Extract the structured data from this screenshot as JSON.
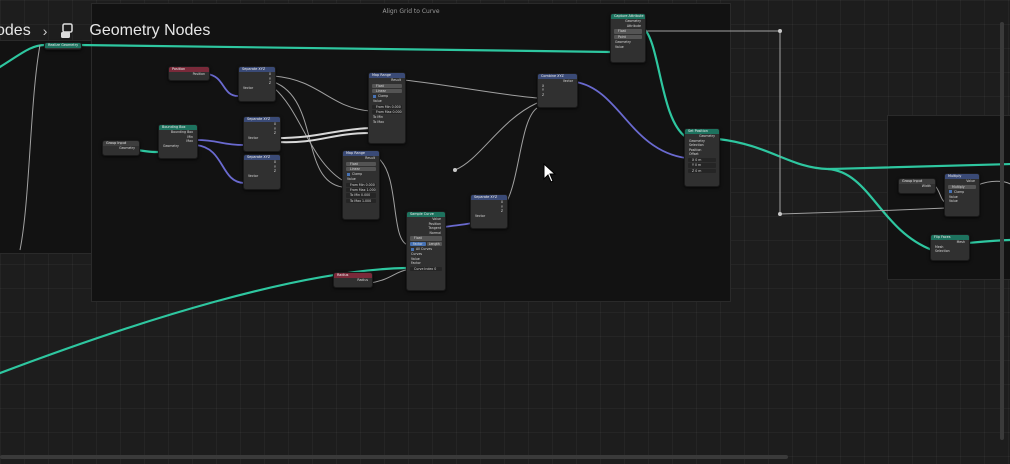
{
  "editor": {
    "title": "Geometry Nodes",
    "breadcrumb_prev": "odes"
  },
  "frames": {
    "align": "Align Grid to Curve"
  },
  "colors": {
    "geometry_socket": "#2ec7a0",
    "vector_socket": "#6363c7",
    "float_socket": "#a1a1a1",
    "field_header": "#3a4a76",
    "geometry_header": "#1d725e",
    "input_header": "#7a2a3a"
  },
  "nodes": {
    "realize": {
      "title": "Realize Geometry"
    },
    "position1": {
      "title": "Position",
      "out": "Position"
    },
    "sep1": {
      "title": "Separate XYZ",
      "x": "X",
      "y": "Y",
      "z": "Z",
      "vec": "Vector"
    },
    "bbox": {
      "title": "Bounding Box",
      "out_bbox": "Bounding Box",
      "min": "Min",
      "max": "Max",
      "geo": "Geometry"
    },
    "group_in1": {
      "title": "Group Input",
      "geo": "Geometry"
    },
    "sep2": {
      "title": "Separate XYZ",
      "x": "X",
      "y": "Y",
      "z": "Z",
      "vec": "Vector"
    },
    "sep3": {
      "title": "Separate XYZ",
      "x": "X",
      "y": "Y",
      "z": "Z",
      "vec": "Vector"
    },
    "map1": {
      "title": "Map Range",
      "result": "Result",
      "dtype": "Float",
      "interp": "Linear",
      "clamp": "Clamp",
      "value": "Value",
      "from_min": "From Min",
      "from_max": "From Max",
      "to_min": "To Min",
      "to_max": "To Max",
      "from_min_v": "0.000",
      "from_max_v": "0.000"
    },
    "map2": {
      "title": "Map Range",
      "result": "Result",
      "dtype": "Float",
      "interp": "Linear",
      "clamp": "Clamp",
      "value": "Value",
      "from_min": "From Min",
      "from_max": "From Max",
      "to_min": "To Min",
      "to_max": "To Max",
      "from_min_v": "0.000",
      "from_max_v": "1.000",
      "to_min_v": "0.000",
      "to_max_v": "1.000"
    },
    "combine": {
      "title": "Combine XYZ",
      "vector": "Vector",
      "x": "X",
      "y": "Y",
      "z": "Z"
    },
    "sample": {
      "title": "Sample Curve",
      "value": "Value",
      "position": "Position",
      "tangent": "Tangent",
      "normal": "Normal",
      "dtype": "Float",
      "mode_a": "Factor",
      "mode_b": "Length",
      "all_curves": "All Curves",
      "curves": "Curves",
      "value_in": "Value",
      "factor": "Factor",
      "curve_index": "Curve Index",
      "curve_index_v": "0"
    },
    "sep4": {
      "title": "Separate XYZ",
      "x": "X",
      "y": "Y",
      "z": "Z",
      "vec": "Vector"
    },
    "radius": {
      "title": "Radius",
      "out": "Radius"
    },
    "capture": {
      "title": "Capture Attribute",
      "geo": "Geometry",
      "attr": "Attribute",
      "dtype": "Float",
      "domain": "Point",
      "geo_in": "Geometry",
      "value": "Value"
    },
    "setpos": {
      "title": "Set Position",
      "geo_out": "Geometry",
      "geo": "Geometry",
      "sel": "Selection",
      "pos": "Position",
      "offset": "Offset",
      "ox": "X",
      "oy": "Y",
      "oz": "Z",
      "ov": "0 m"
    },
    "group_in2": {
      "title": "Group Input",
      "out": "Width"
    },
    "multiply": {
      "title": "Multiply",
      "value": "Value",
      "op": "Multiply",
      "clamp": "Clamp",
      "v1": "Value",
      "v2": "Value"
    },
    "flip": {
      "title": "Flip Faces",
      "mesh_out": "Mesh",
      "mesh": "Mesh",
      "sel": "Selection"
    }
  }
}
